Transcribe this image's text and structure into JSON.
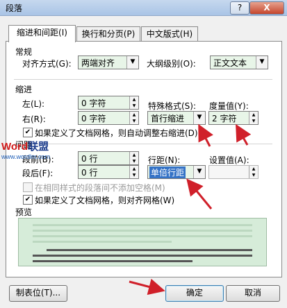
{
  "window": {
    "title": "段落",
    "help_label": "?",
    "close_label": "X"
  },
  "tabs": [
    {
      "label": "缩进和间距(I)",
      "active": true
    },
    {
      "label": "换行和分页(P)",
      "active": false
    },
    {
      "label": "中文版式(H)",
      "active": false
    }
  ],
  "general": {
    "heading": "常规",
    "alignment_label": "对齐方式(G):",
    "alignment_value": "两端对齐",
    "outline_label": "大纲级别(O):",
    "outline_value": "正文文本"
  },
  "indent": {
    "heading": "缩进",
    "left_label": "左(L):",
    "left_value": "0 字符",
    "right_label": "右(R):",
    "right_value": "0 字符",
    "special_label": "特殊格式(S):",
    "special_value": "首行缩进",
    "amount_label": "度量值(Y):",
    "amount_value": "2 字符",
    "auto_adjust_label": "如果定义了文档网格，则自动调整右缩进(D)",
    "auto_adjust_checked": true
  },
  "spacing": {
    "heading": "间距",
    "before_label": "段前(B):",
    "before_value": "0 行",
    "after_label": "段后(F):",
    "after_value": "0 行",
    "line_label": "行距(N):",
    "line_value": "单倍行距",
    "setting_label": "设置值(A):",
    "setting_value": "",
    "no_space_label": "在相同样式的段落间不添加空格(M)",
    "no_space_checked": false,
    "snap_grid_label": "如果定义了文档网格，则对齐网格(W)",
    "snap_grid_checked": true
  },
  "preview": {
    "heading": "预览"
  },
  "buttons": {
    "tabs_label": "制表位(T)...",
    "ok_label": "确定",
    "cancel_label": "取消"
  },
  "watermark": {
    "brand_a": "Word",
    "brand_b": "联盟",
    "url": "www.wordlm.com"
  },
  "colors": {
    "accent_arrow": "#d0202a",
    "field_bg": "#e8f5e8",
    "selection": "#3472c6"
  }
}
